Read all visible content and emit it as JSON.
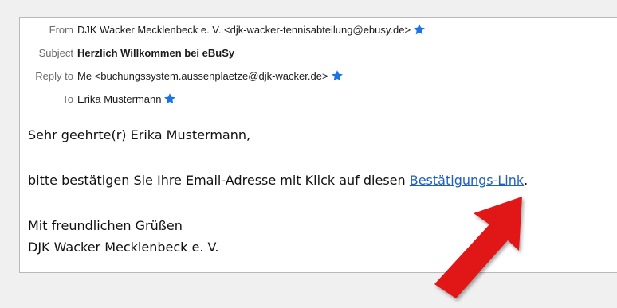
{
  "header": {
    "from_label": "From",
    "from_value": "DJK Wacker Mecklenbeck e. V. <djk-wacker-tennisabteilung@ebusy.de>",
    "subject_label": "Subject",
    "subject_value": "Herzlich Willkommen bei eBuSy",
    "replyto_label": "Reply to",
    "replyto_value": "Me <buchungssystem.aussenplaetze@djk-wacker.de>",
    "to_label": "To",
    "to_value": "Erika Mustermann"
  },
  "body": {
    "greeting": "Sehr geehrte(r) Erika Mustermann,",
    "sentence_prefix": "bitte bestätigen Sie Ihre Email-Adresse mit Klick auf diesen ",
    "link_text": "Bestätigungs-Link",
    "sentence_suffix": ".",
    "closing": "Mit freundlichen Grüßen",
    "signature": "DJK Wacker Mecklenbeck e. V."
  },
  "colors": {
    "star": "#1a73e8",
    "link": "#1f5fbf",
    "arrow": "#e11414"
  },
  "icons": {
    "star": "star-icon",
    "arrow": "red-arrow-annotation"
  }
}
